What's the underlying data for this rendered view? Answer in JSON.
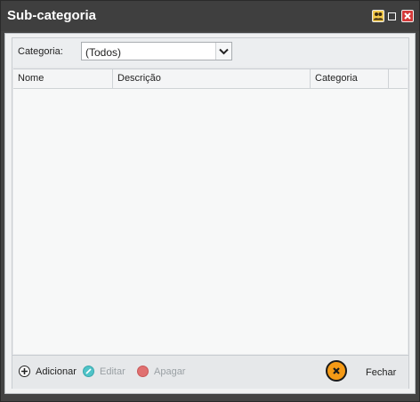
{
  "window": {
    "title": "Sub-categoria",
    "accent_close": "#d43a3a",
    "accent_users": "#f2c84b"
  },
  "filter": {
    "label": "Categoria:",
    "selected": "(Todos)"
  },
  "grid": {
    "columns": [
      "Nome",
      "Descrição",
      "Categoria"
    ],
    "rows": []
  },
  "actions": {
    "add": "Adicionar",
    "edit": "Editar",
    "delete": "Apagar",
    "close": "Fechar"
  },
  "icons": {
    "users": "users-icon",
    "maximize": "maximize-icon",
    "close": "close-icon",
    "dropdown": "chevron-down-icon",
    "add": "plus-circle-icon",
    "edit": "edit-icon",
    "delete": "delete-icon",
    "fechar": "close-circle-icon"
  }
}
